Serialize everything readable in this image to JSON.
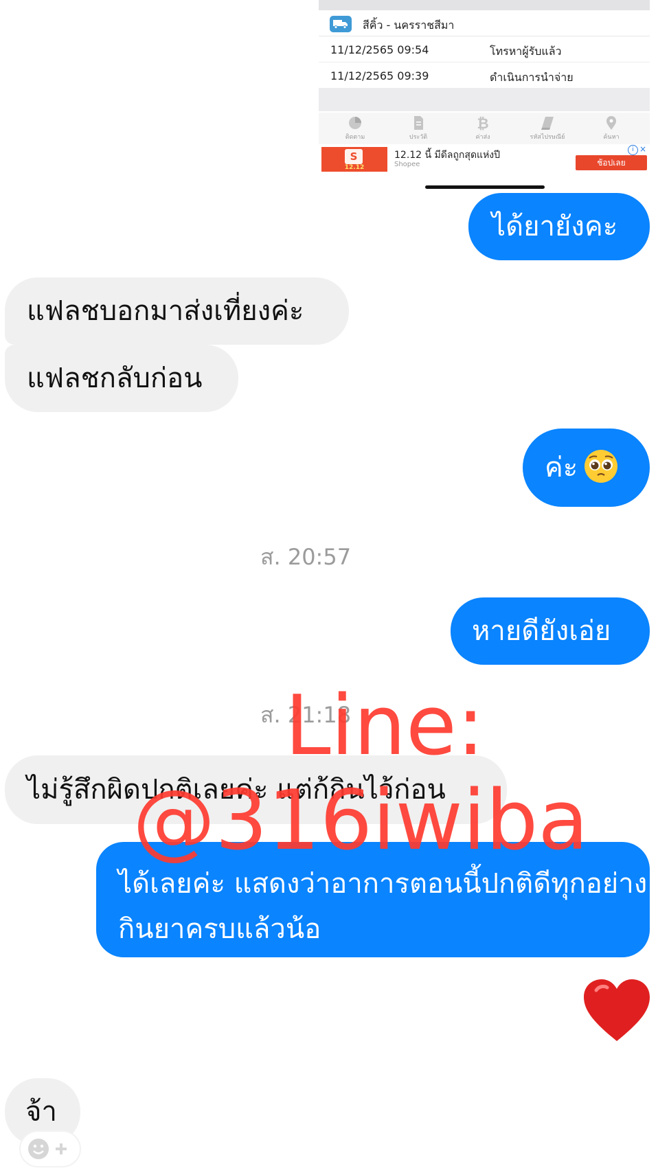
{
  "tracking_screenshot": {
    "route": "สีคิ้ว - นครราชสีมา",
    "events": [
      {
        "time": "11/12/2565 09:54",
        "status": "โทรหาผู้รับแล้ว"
      },
      {
        "time": "11/12/2565 09:39",
        "status": "ดำเนินการนำจ่าย"
      }
    ],
    "tabs": [
      {
        "label": "ติดตาม",
        "icon": "pie-chart-icon"
      },
      {
        "label": "ประวัติ",
        "icon": "document-icon"
      },
      {
        "label": "ค่าส่ง",
        "icon": "bitcoin-icon"
      },
      {
        "label": "รหัสไปรษณีย์",
        "icon": "book-icon"
      },
      {
        "label": "ค้นหา",
        "icon": "map-pin-icon"
      }
    ],
    "ad": {
      "image_text": "12.12",
      "title": "12.12 นี้ มีดีลถูกสุดแห่งปี",
      "brand": "Shopee",
      "button": "ช้อปเลย",
      "info": "i",
      "close": "×",
      "brand_color": "#ee4d2d"
    }
  },
  "messages": [
    {
      "id": "m1",
      "side": "out",
      "text": "ได้ยายังคะ"
    },
    {
      "id": "m2",
      "side": "in",
      "text": "แฟลชบอกมาส่งเที่ยงค่ะ"
    },
    {
      "id": "m3",
      "side": "in",
      "text": "แฟลชกลับก่อน"
    },
    {
      "id": "m4",
      "side": "out",
      "text": "ค่ะ",
      "emoji": "pleading-face-icon"
    },
    {
      "id": "m5",
      "side": "out",
      "text": "หายดียังเอ่ย"
    },
    {
      "id": "m6",
      "side": "in",
      "text": "ไม่รู้สึกผิดปกติเลยค่ะ แต่ก้กินไว้ก่อน"
    },
    {
      "id": "m7",
      "side": "out",
      "text": "ได้เลยค่ะ แสดงว่าอาการตอนนี้ปกติดีทุกอย่าง กินยาครบแล้วน้อ"
    },
    {
      "id": "m8",
      "side": "out",
      "emoji": "red-heart-icon"
    },
    {
      "id": "m9",
      "side": "in",
      "text": "จ้า"
    }
  ],
  "timestamps": [
    "ส. 20:57",
    "ส. 21:18"
  ],
  "watermark": {
    "line1": "Line:",
    "line2": "@316iwiba",
    "color": "#ff3b30"
  },
  "colors": {
    "outgoing_bubble": "#0a84ff",
    "incoming_bubble": "#f0f0f0",
    "timestamp": "#9b9b9b"
  }
}
